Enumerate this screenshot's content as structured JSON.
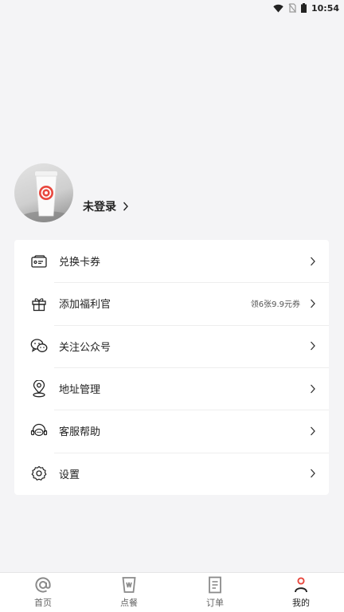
{
  "status_bar": {
    "time": "10:54"
  },
  "profile": {
    "login_label": "未登录"
  },
  "menu": {
    "items": [
      {
        "label": "兑换卡券",
        "hint": ""
      },
      {
        "label": "添加福利官",
        "hint": "领6张9.9元券"
      },
      {
        "label": "关注公众号",
        "hint": ""
      },
      {
        "label": "地址管理",
        "hint": ""
      },
      {
        "label": "客服帮助",
        "hint": ""
      },
      {
        "label": "设置",
        "hint": ""
      }
    ]
  },
  "bottom_nav": {
    "items": [
      {
        "label": "首页",
        "icon": "home-at-icon"
      },
      {
        "label": "点餐",
        "icon": "cup-icon"
      },
      {
        "label": "订单",
        "icon": "order-doc-icon"
      },
      {
        "label": "我的",
        "icon": "person-icon",
        "active": true
      }
    ]
  },
  "colors": {
    "accent": "#e8473d",
    "background": "#f4f4f6",
    "card": "#ffffff"
  }
}
